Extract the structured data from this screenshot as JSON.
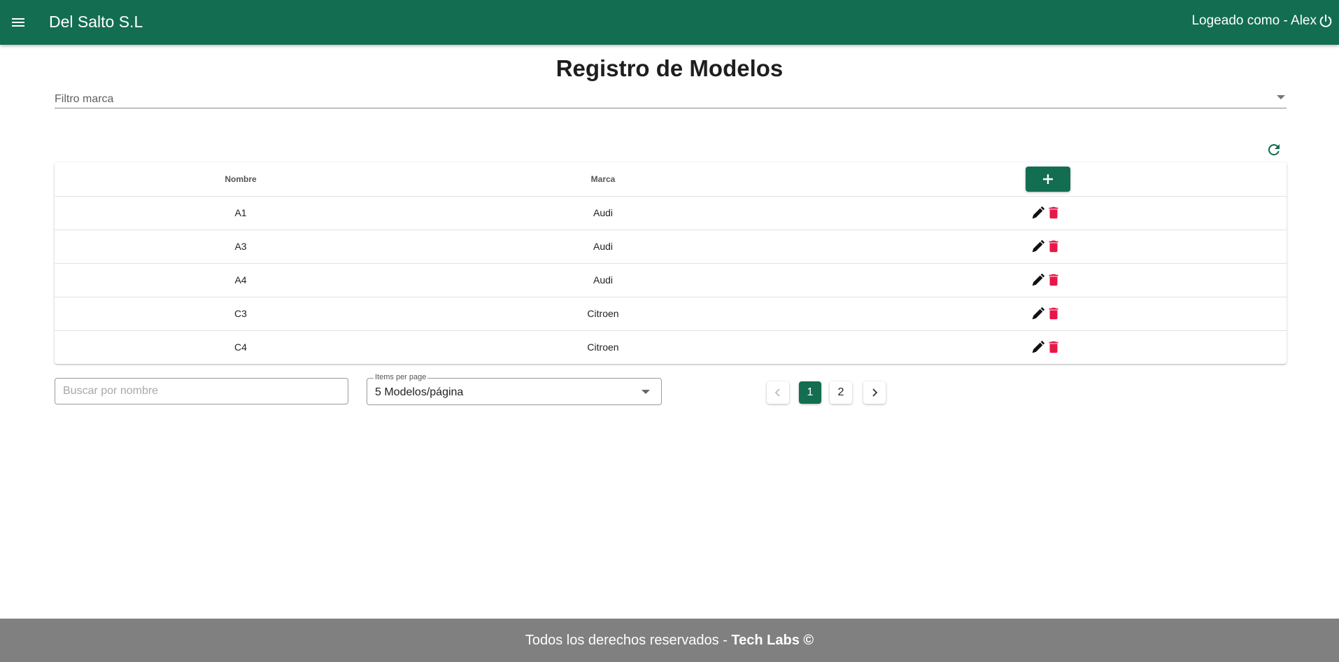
{
  "header": {
    "brand": "Del Salto S.L",
    "user_label": "Logeado como - Alex",
    "color": "#136d51"
  },
  "page": {
    "title": "Registro de Modelos",
    "filter_label": "Filtro marca"
  },
  "table": {
    "columns": [
      "Nombre",
      "Marca"
    ],
    "rows": [
      {
        "nombre": "A1",
        "marca": "Audi"
      },
      {
        "nombre": "A3",
        "marca": "Audi"
      },
      {
        "nombre": "A4",
        "marca": "Audi"
      },
      {
        "nombre": "C3",
        "marca": "Citroen"
      },
      {
        "nombre": "C4",
        "marca": "Citroen"
      }
    ],
    "edit_icon": "pencil-icon",
    "delete_icon": "trash-icon",
    "delete_color": "#e8174a"
  },
  "search": {
    "placeholder": "Buscar por nombre",
    "value": ""
  },
  "per_page": {
    "legend": "Items per page",
    "value": "5 Modelos/página"
  },
  "pagination": {
    "pages": [
      "1",
      "2"
    ],
    "current": "1"
  },
  "footer": {
    "text": "Todos los derechos reservados - ",
    "brand": "Tech Labs ©"
  }
}
